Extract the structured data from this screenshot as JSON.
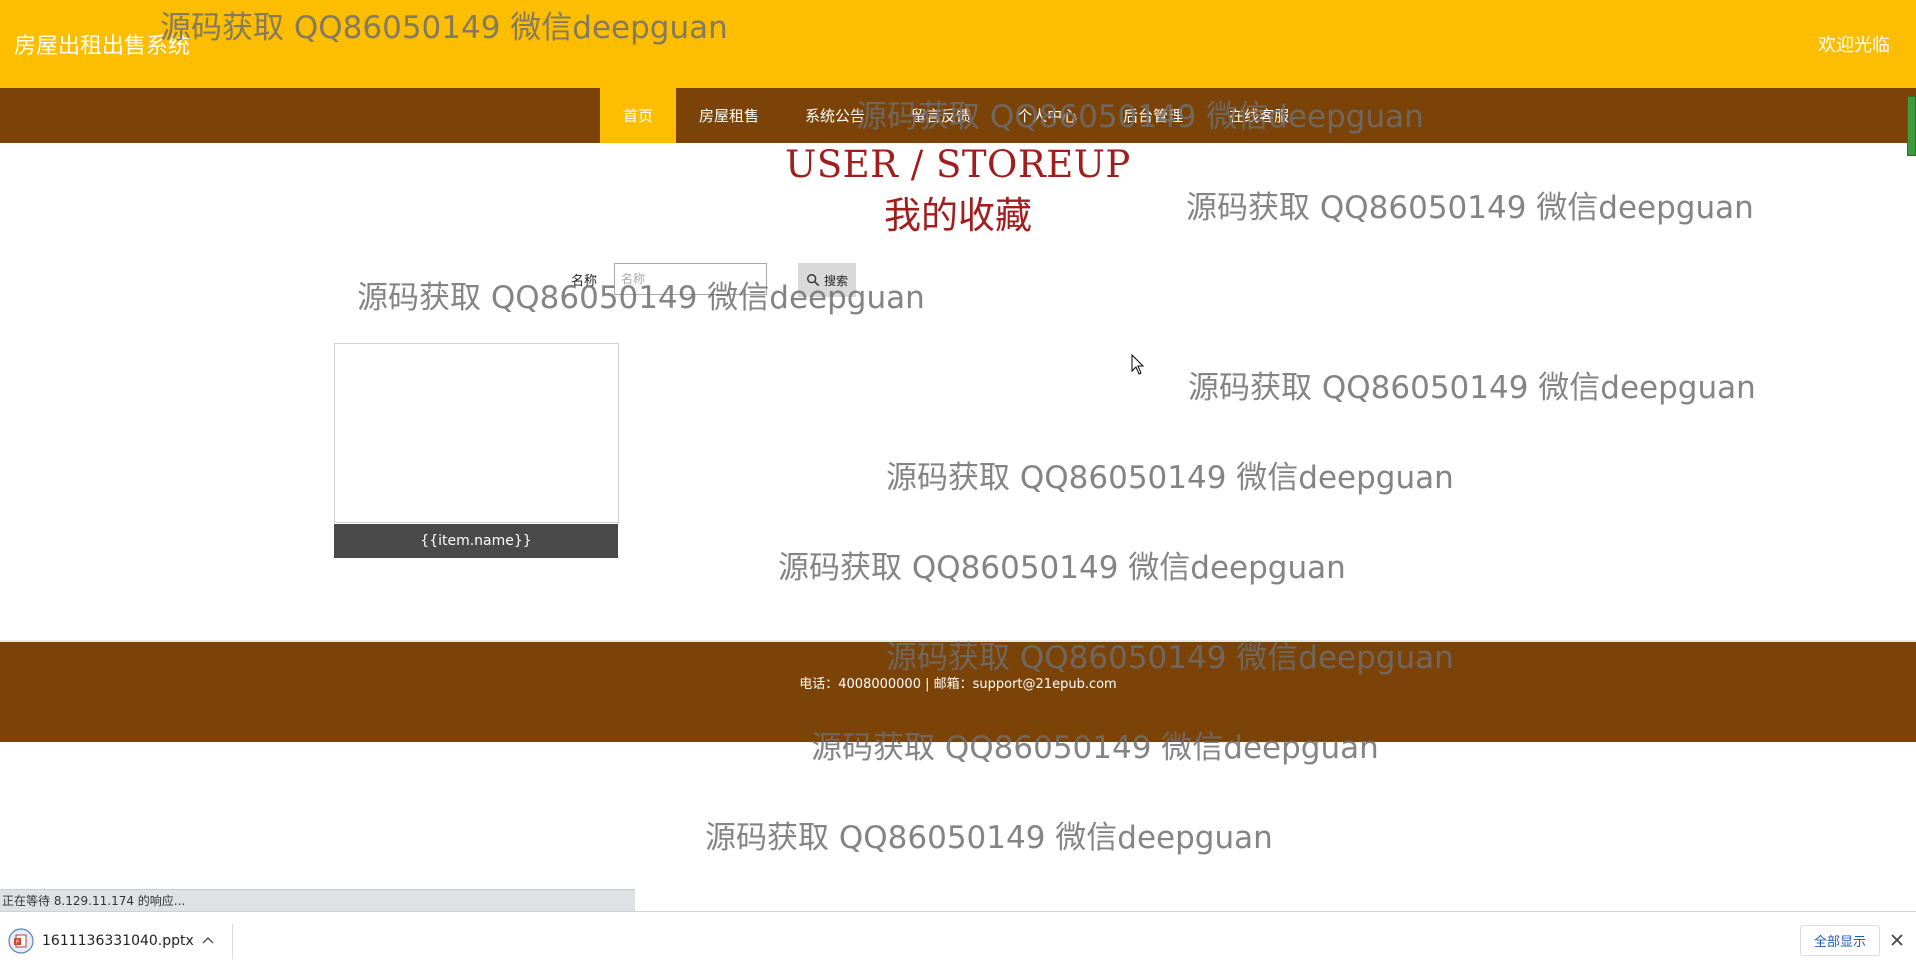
{
  "header": {
    "site_title": "房屋出租出售系统",
    "welcome": "欢迎光临"
  },
  "nav": {
    "items": [
      {
        "label": "首页",
        "active": true
      },
      {
        "label": "房屋租售",
        "active": false
      },
      {
        "label": "系统公告",
        "active": false
      },
      {
        "label": "留言反馈",
        "active": false
      },
      {
        "label": "个人中心",
        "active": false
      },
      {
        "label": "后台管理",
        "active": false
      },
      {
        "label": "在线客服",
        "active": false
      }
    ]
  },
  "page": {
    "title_en": "USER / STOREUP",
    "title_cn": "我的收藏"
  },
  "search": {
    "label": "名称",
    "placeholder": "名称",
    "button_label": "搜索"
  },
  "items": [
    {
      "name": "{{item.name}}"
    }
  ],
  "footer": {
    "contact": "电话：4008000000 | 邮箱：support@21epub.com"
  },
  "browser": {
    "status_text": "正在等待 8.129.11.174 的响应...",
    "download_file": "1611136331040.pptx",
    "show_all_label": "全部显示"
  },
  "watermark": "源码获取 QQ86050149 微信deepguan",
  "colors": {
    "header": "#fdbd00",
    "nav": "#7b4307",
    "heading": "#a11e1e",
    "card_caption": "#4a4a4a"
  }
}
